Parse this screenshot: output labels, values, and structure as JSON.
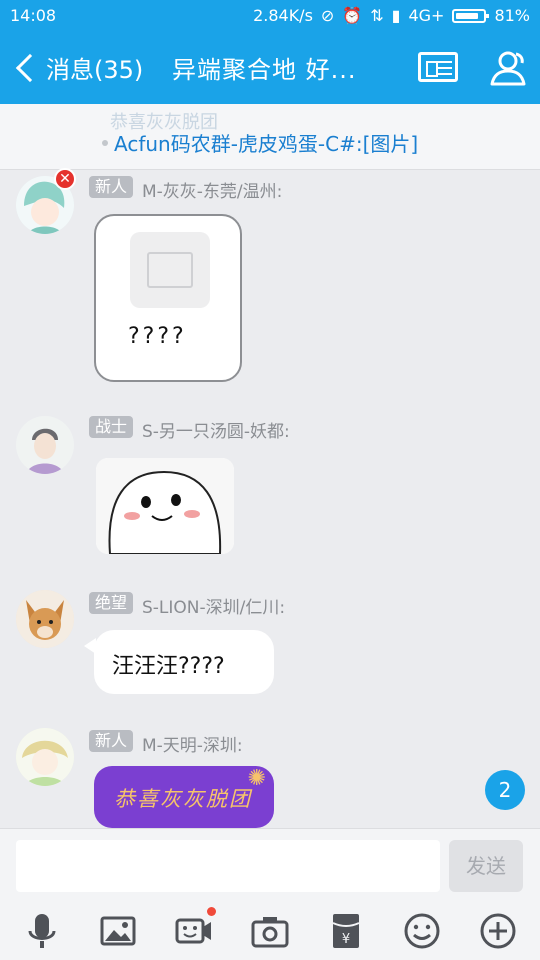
{
  "status_bar": {
    "time": "14:08",
    "network_speed": "2.84K/s",
    "network_type": "4G+",
    "battery": "81%"
  },
  "header": {
    "back_label": "消息(35)",
    "title": "异端聚合地 好..."
  },
  "notice": {
    "ghost_text": "恭喜灰灰脱团",
    "text": "Acfun码农群-虎皮鸡蛋-C#:[图片]"
  },
  "messages": [
    {
      "badge": "新人",
      "sender": "M-灰灰-东莞/温州:",
      "content": "????"
    },
    {
      "badge": "战士",
      "sender": "S-另一只汤圆-妖都:",
      "content": ""
    },
    {
      "badge": "绝望",
      "sender": "S-LION-深圳/仁川:",
      "content": "汪汪汪????"
    },
    {
      "badge": "新人",
      "sender": "M-天明-深圳:",
      "content": "恭喜灰灰脱团"
    }
  ],
  "unread_count": "2",
  "input": {
    "placeholder": "",
    "send_label": "发送"
  },
  "colors": {
    "accent": "#1aa3e8",
    "background": "#ebecef",
    "badge": "#b9bcc2",
    "sticker_purple": "#7b3fd1"
  }
}
